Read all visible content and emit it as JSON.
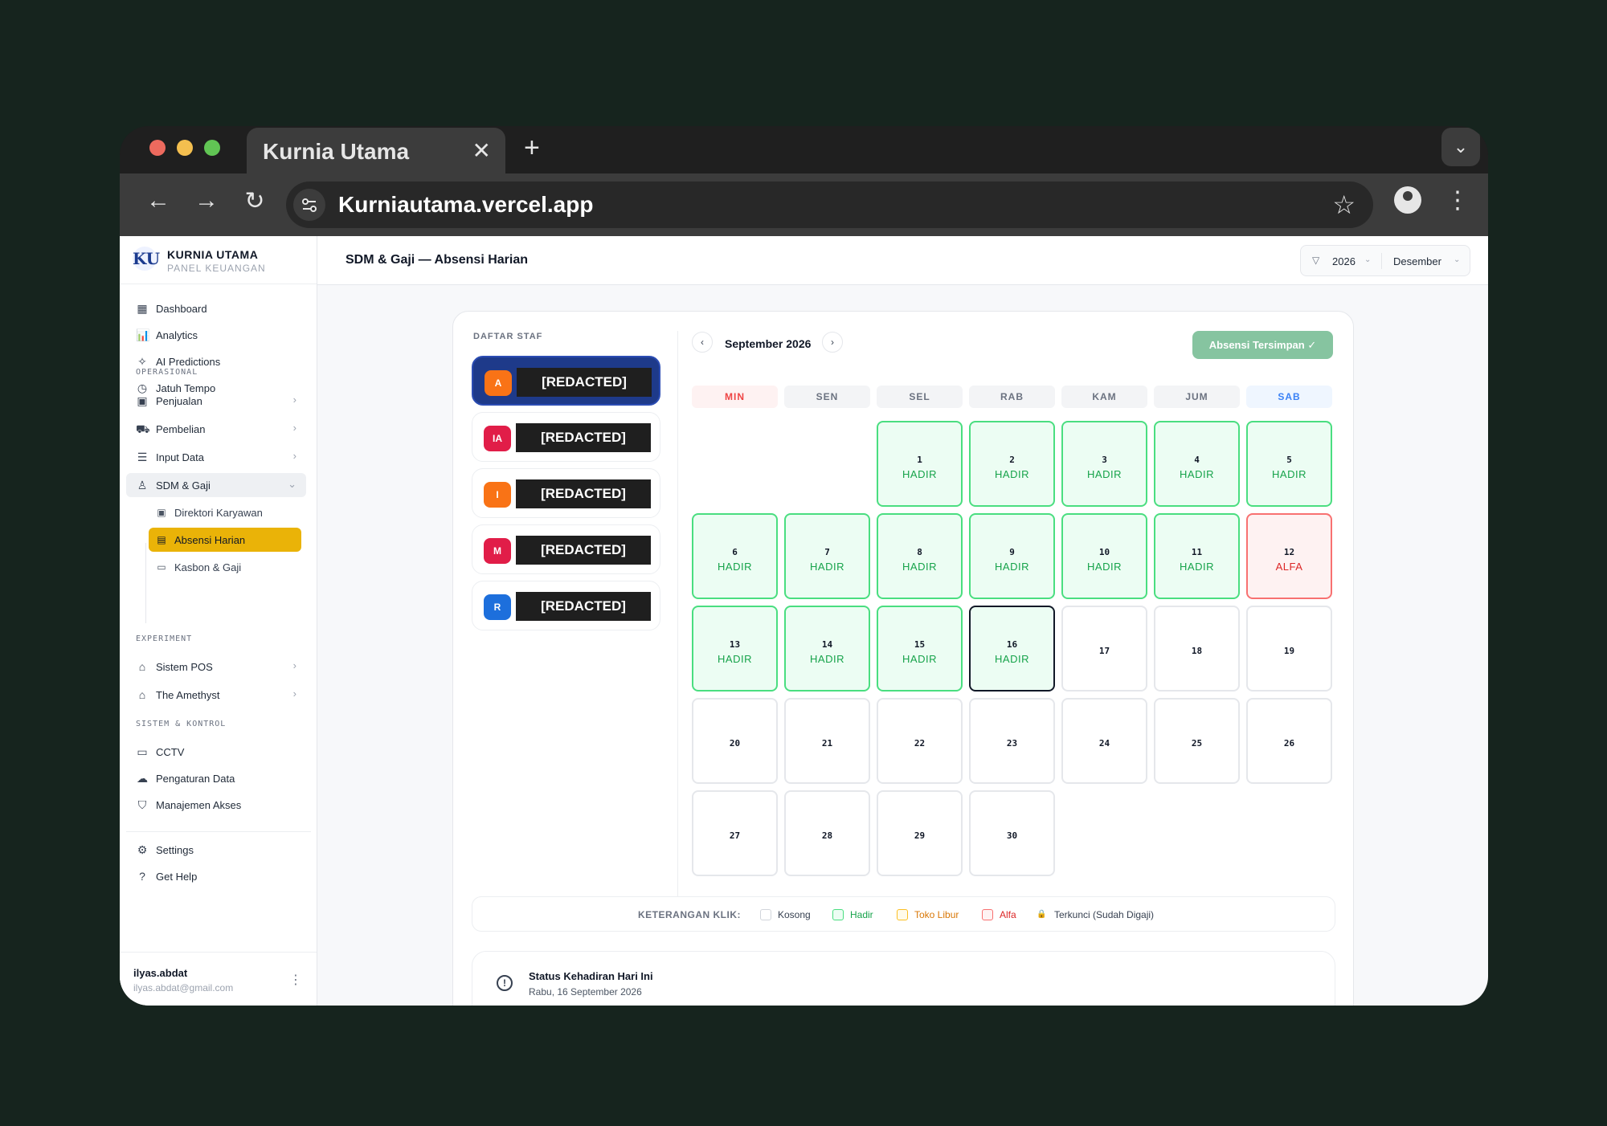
{
  "browser": {
    "tab_title": "Kurnia Utama",
    "tab_close": "✕",
    "new_tab": "+",
    "tab_menu": "⌄",
    "url": "Kurniautama.vercel.app",
    "back": "←",
    "forward": "→",
    "reload": "↻",
    "bookmark": "☆",
    "menu": "⋮"
  },
  "sidebar": {
    "brand_logo": "KU",
    "brand_name": "KURNIA UTAMA",
    "brand_sub": "PANEL KEUANGAN",
    "main": [
      {
        "label": "Dashboard",
        "icon": "dashboard-icon",
        "glyph": "▦"
      },
      {
        "label": "Analytics",
        "icon": "analytics-icon",
        "glyph": "📊"
      },
      {
        "label": "AI Predictions",
        "icon": "sparkle-icon",
        "glyph": "✧"
      },
      {
        "label": "Jatuh Tempo",
        "icon": "clock-icon",
        "glyph": "◷"
      }
    ],
    "section_operasional": "OPERASIONAL",
    "operasional": [
      {
        "label": "Penjualan",
        "icon": "shopping-bag-icon",
        "glyph": "▣"
      },
      {
        "label": "Pembelian",
        "icon": "truck-icon",
        "glyph": "⛟"
      },
      {
        "label": "Input Data",
        "icon": "database-icon",
        "glyph": "☰"
      },
      {
        "label": "SDM & Gaji",
        "icon": "users-icon",
        "glyph": "♙"
      }
    ],
    "sdm_sub": [
      {
        "label": "Direktori Karyawan",
        "icon": "id-card-icon",
        "glyph": "▣"
      },
      {
        "label": "Absensi Harian",
        "icon": "calendar-icon",
        "glyph": "▤"
      },
      {
        "label": "Kasbon & Gaji",
        "icon": "wallet-icon",
        "glyph": "▭"
      }
    ],
    "section_experiment": "EXPERIMENT",
    "experiment": [
      {
        "label": "Sistem POS",
        "icon": "store-icon",
        "glyph": "⌂"
      },
      {
        "label": "The Amethyst",
        "icon": "home-icon",
        "glyph": "⌂"
      }
    ],
    "section_sistem": "SISTEM & KONTROL",
    "sistem": [
      {
        "label": "CCTV",
        "icon": "video-icon",
        "glyph": "▭"
      },
      {
        "label": "Pengaturan Data",
        "icon": "cloud-upload-icon",
        "glyph": "☁"
      },
      {
        "label": "Manajemen Akses",
        "icon": "shield-icon",
        "glyph": "⛉"
      }
    ],
    "bottom": [
      {
        "label": "Settings",
        "icon": "gear-icon",
        "glyph": "⚙"
      },
      {
        "label": "Get Help",
        "icon": "help-icon",
        "glyph": "?"
      }
    ],
    "chevron": "›",
    "chevron_open": "⌄",
    "user_name": "ilyas.abdat",
    "user_email": "ilyas.abdat@gmail.com",
    "user_menu": "⋮"
  },
  "header": {
    "title": "SDM & Gaji — Absensi Harian",
    "filter_icon": "▽",
    "year": "2026",
    "month": "Desember",
    "chev": "⌄"
  },
  "staff": {
    "title": "DAFTAR STAF",
    "items": [
      {
        "initial": "A",
        "name": "[REDACTED]",
        "color": "#f97316",
        "selected": true
      },
      {
        "initial": "IA",
        "name": "[REDACTED]",
        "color": "#e11d48",
        "selected": false
      },
      {
        "initial": "I",
        "name": "[REDACTED]",
        "color": "#f97316",
        "selected": false
      },
      {
        "initial": "M",
        "name": "[REDACTED]",
        "color": "#e11d48",
        "selected": false
      },
      {
        "initial": "R",
        "name": "[REDACTED]",
        "color": "#1d6fdc",
        "selected": false
      }
    ]
  },
  "calendar": {
    "month_label": "September 2026",
    "prev": "‹",
    "next": "›",
    "save_label": "Absensi Tersimpan ✓",
    "weekdays": [
      "MIN",
      "SEN",
      "SEL",
      "RAB",
      "KAM",
      "JUM",
      "SAB"
    ],
    "first_weekday_index": 2,
    "today": 16,
    "days": [
      {
        "d": 1,
        "s": "HADIR"
      },
      {
        "d": 2,
        "s": "HADIR"
      },
      {
        "d": 3,
        "s": "HADIR"
      },
      {
        "d": 4,
        "s": "HADIR"
      },
      {
        "d": 5,
        "s": "HADIR"
      },
      {
        "d": 6,
        "s": "HADIR"
      },
      {
        "d": 7,
        "s": "HADIR"
      },
      {
        "d": 8,
        "s": "HADIR"
      },
      {
        "d": 9,
        "s": "HADIR"
      },
      {
        "d": 10,
        "s": "HADIR"
      },
      {
        "d": 11,
        "s": "HADIR"
      },
      {
        "d": 12,
        "s": "ALFA"
      },
      {
        "d": 13,
        "s": "HADIR"
      },
      {
        "d": 14,
        "s": "HADIR"
      },
      {
        "d": 15,
        "s": "HADIR"
      },
      {
        "d": 16,
        "s": "HADIR"
      },
      {
        "d": 17,
        "s": ""
      },
      {
        "d": 18,
        "s": ""
      },
      {
        "d": 19,
        "s": ""
      },
      {
        "d": 20,
        "s": ""
      },
      {
        "d": 21,
        "s": ""
      },
      {
        "d": 22,
        "s": ""
      },
      {
        "d": 23,
        "s": ""
      },
      {
        "d": 24,
        "s": ""
      },
      {
        "d": 25,
        "s": ""
      },
      {
        "d": 26,
        "s": ""
      },
      {
        "d": 27,
        "s": ""
      },
      {
        "d": 28,
        "s": ""
      },
      {
        "d": 29,
        "s": ""
      },
      {
        "d": 30,
        "s": ""
      }
    ]
  },
  "legend": {
    "title": "KETERANGAN KLIK:",
    "items": [
      {
        "label": "Kosong",
        "color": "#374151",
        "border": "#d1d5db",
        "fill": "#ffffff"
      },
      {
        "label": "Hadir",
        "color": "#16a34a",
        "border": "#4ade80",
        "fill": "#ecfdf3"
      },
      {
        "label": "Toko Libur",
        "color": "#d97706",
        "border": "#fbbf24",
        "fill": "#fffbeb"
      },
      {
        "label": "Alfa",
        "color": "#dc2626",
        "border": "#f87171",
        "fill": "#fef2f2"
      },
      {
        "label": "Terkunci (Sudah Digaji)",
        "color": "#374151",
        "border": "#ffffff",
        "fill": "#ffffff",
        "glyph": "🔒"
      }
    ]
  },
  "status": {
    "title": "Status Kehadiran Hari Ini",
    "date": "Rabu, 16 September 2026",
    "icon": "!"
  }
}
